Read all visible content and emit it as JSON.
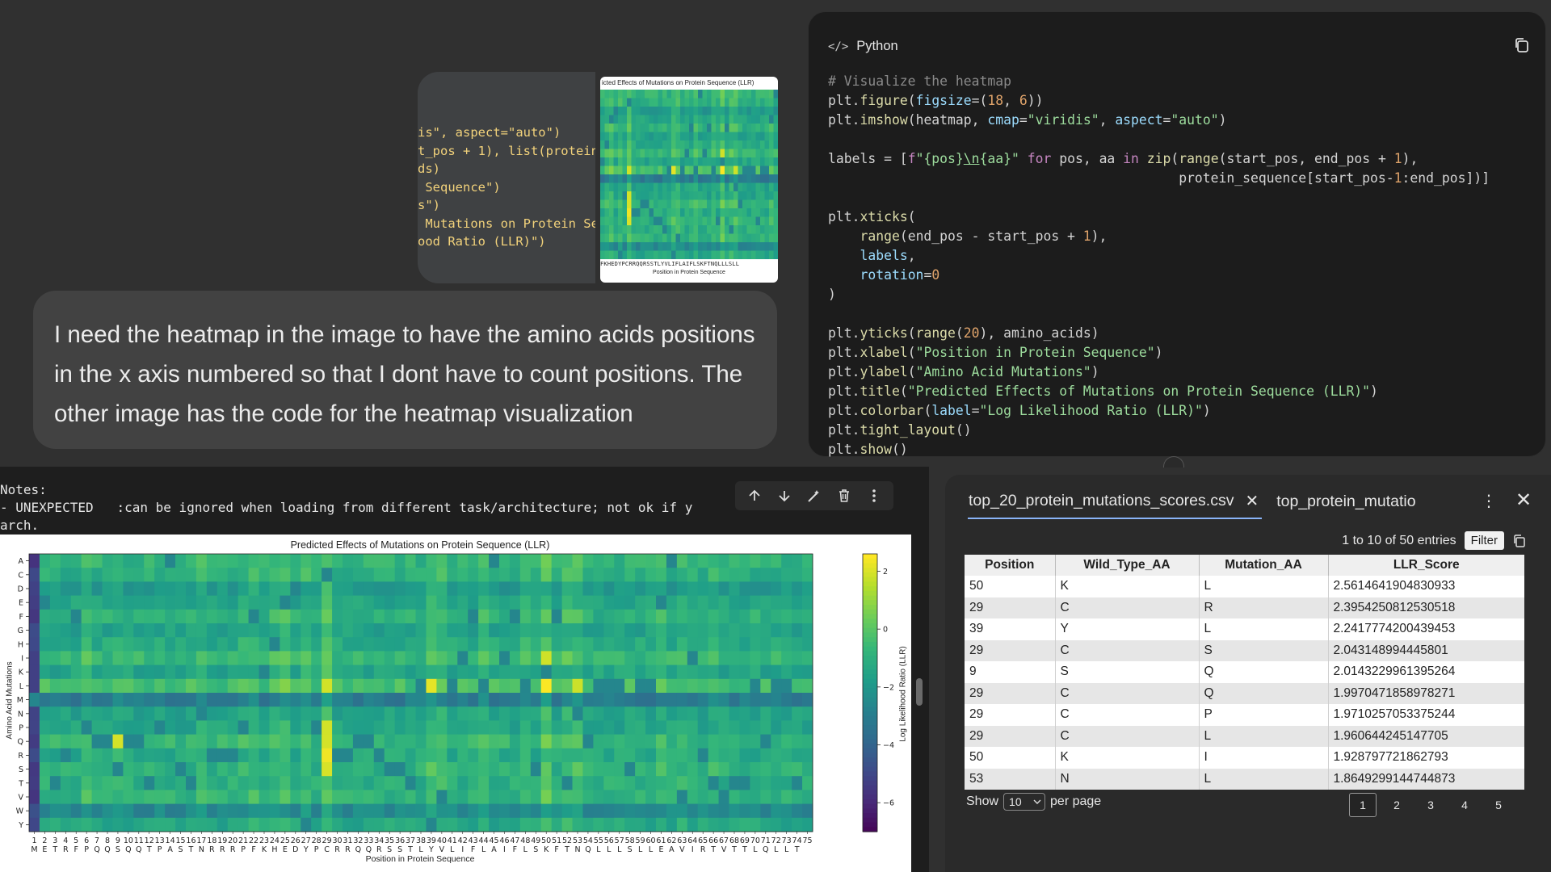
{
  "chat": {
    "attachment_code_lines": [
      "is\", aspect=\"auto\")",
      "t_pos + 1), list(protein_se",
      "ds)",
      " Sequence\")",
      "s\")",
      " Mutations on Protein Seque",
      "ood Ratio (LLR)\")"
    ],
    "attachment_heatmap": {
      "title": "icted Effects of Mutations on Protein Sequence (LLR)",
      "ticks": "FKHEDYPCRRQQRSSTLYVLIFLAIFLSKFTNQLLLSLL",
      "xlabel": "Position in Protein Sequence"
    },
    "user_message": "I need the heatmap in the image to have the amino acids positions in the x axis numbered so that I dont have to count positions. The other image has the code for the heatmap visualization"
  },
  "code_panel": {
    "language": "Python",
    "lang_icon": "</>"
  },
  "notebook": {
    "notes": "Notes:\n- UNEXPECTED   :can be ignored when loading from different task/architecture; not ok if y\narch.",
    "plot": {
      "title": "Predicted Effects of Mutations on Protein Sequence (LLR)",
      "xlabel": "Position in Protein Sequence",
      "ylabel": "Amino Acid Mutations",
      "colorbar_label": "Log Likelihood Ratio (LLR)"
    }
  },
  "chart_data": {
    "type": "heatmap",
    "title": "Predicted Effects of Mutations on Protein Sequence (LLR)",
    "xlabel": "Position in Protein Sequence",
    "ylabel": "Amino Acid Mutations",
    "y_categories": [
      "A",
      "C",
      "D",
      "E",
      "F",
      "G",
      "H",
      "I",
      "K",
      "L",
      "M",
      "N",
      "P",
      "Q",
      "R",
      "S",
      "T",
      "V",
      "W",
      "Y"
    ],
    "x_positions": [
      1,
      2,
      3,
      4,
      5,
      6,
      7,
      8,
      9,
      10,
      11,
      12,
      13,
      14,
      15,
      16,
      17,
      18,
      19,
      20,
      21,
      22,
      23,
      24,
      25,
      26,
      27,
      28,
      29,
      30,
      31,
      32,
      33,
      34,
      35,
      36,
      37,
      38,
      39,
      40,
      41,
      42,
      43,
      44,
      45,
      46,
      47,
      48,
      49,
      50,
      51,
      52,
      53,
      54,
      55,
      56,
      57,
      58,
      59,
      60,
      61,
      62,
      63,
      64,
      65,
      66,
      67,
      68,
      69,
      70,
      71,
      72,
      73,
      74,
      75
    ],
    "x_residues": [
      "M",
      "E",
      "T",
      "R",
      "F",
      "P",
      "Q",
      "Q",
      "S",
      "Q",
      "Q",
      "T",
      "P",
      "A",
      "S",
      "T",
      "N",
      "R",
      "R",
      "R",
      "P",
      "F",
      "K",
      "H",
      "E",
      "D",
      "Y",
      "P",
      "C",
      "R",
      "R",
      "Q",
      "Q",
      "R",
      "S",
      "S",
      "T",
      "L",
      "Y",
      "V",
      "L",
      "I",
      "F",
      "L",
      "A",
      "I",
      "F",
      "L",
      "S",
      "K",
      "F",
      "T",
      "N",
      "Q",
      "L",
      "L",
      "L",
      "S",
      "L",
      "L",
      "E",
      "A",
      "V",
      "I",
      "R",
      "T",
      "V",
      "T",
      "T",
      "L",
      "Q",
      "L",
      "L",
      "T"
    ],
    "colorbar": {
      "label": "Log Likelihood Ratio (LLR)",
      "ticks": [
        2,
        0,
        -2,
        -4,
        -6
      ],
      "range": [
        -7,
        2.6
      ]
    },
    "notable_cells": [
      {
        "position": 50,
        "mutation": "L",
        "value": 2.5614641904830933
      },
      {
        "position": 29,
        "mutation": "R",
        "value": 2.3954250812530518
      },
      {
        "position": 39,
        "mutation": "L",
        "value": 2.2417774200439453
      },
      {
        "position": 29,
        "mutation": "S",
        "value": 2.043148994445801
      },
      {
        "position": 9,
        "mutation": "Q",
        "value": 2.0143229961395264
      },
      {
        "position": 29,
        "mutation": "Q",
        "value": 1.9970471858978271
      },
      {
        "position": 29,
        "mutation": "P",
        "value": 1.9710257053375244
      },
      {
        "position": 29,
        "mutation": "L",
        "value": 1.960644245147705
      },
      {
        "position": 50,
        "mutation": "I",
        "value": 1.928797721862793
      },
      {
        "position": 53,
        "mutation": "L",
        "value": 1.8649299144744873
      }
    ]
  },
  "table_panel": {
    "tabs": [
      {
        "label": "top_20_protein_mutations_scores.csv",
        "active": true
      },
      {
        "label": "top_protein_mutatio",
        "active": false
      }
    ],
    "entries_text": "1 to 10 of 50 entries",
    "filter_label": "Filter",
    "columns": [
      "Position",
      "Wild_Type_AA",
      "Mutation_AA",
      "LLR_Score"
    ],
    "rows": [
      [
        "50",
        "K",
        "L",
        "2.5614641904830933"
      ],
      [
        "29",
        "C",
        "R",
        "2.3954250812530518"
      ],
      [
        "39",
        "Y",
        "L",
        "2.2417774200439453"
      ],
      [
        "29",
        "C",
        "S",
        "2.043148994445801"
      ],
      [
        "9",
        "S",
        "Q",
        "2.0143229961395264"
      ],
      [
        "29",
        "C",
        "Q",
        "1.9970471858978271"
      ],
      [
        "29",
        "C",
        "P",
        "1.9710257053375244"
      ],
      [
        "29",
        "C",
        "L",
        "1.960644245147705"
      ],
      [
        "50",
        "K",
        "I",
        "1.928797721862793"
      ],
      [
        "53",
        "N",
        "L",
        "1.8649299144744873"
      ]
    ],
    "show_label": "Show",
    "per_page_value": "10",
    "per_page_label": "per page",
    "pages": [
      "1",
      "2",
      "3",
      "4",
      "5"
    ],
    "active_page": "1"
  }
}
